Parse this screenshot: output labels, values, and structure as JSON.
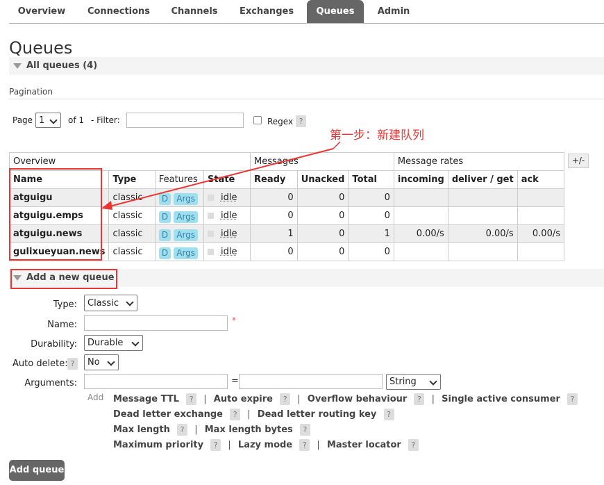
{
  "nav": {
    "tabs": [
      {
        "label": "Overview"
      },
      {
        "label": "Connections"
      },
      {
        "label": "Channels"
      },
      {
        "label": "Exchanges"
      },
      {
        "label": "Queues"
      },
      {
        "label": "Admin"
      }
    ],
    "active": "Queues"
  },
  "page_title": "Queues",
  "all_queues": {
    "label": "All queues (4)"
  },
  "pagination": {
    "label": "Pagination",
    "page_label": "Page",
    "page_value": "1",
    "of_label": "of 1",
    "filter_label": "- Filter:",
    "filter_value": "",
    "regex_label": "Regex",
    "help": "?"
  },
  "annotation": "第一步：新建队列",
  "table": {
    "group_headers": {
      "overview": "Overview",
      "messages": "Messages",
      "rates": "Message rates"
    },
    "toggle": "+/-",
    "columns": [
      "Name",
      "Type",
      "Features",
      "State",
      "Ready",
      "Unacked",
      "Total",
      "incoming",
      "deliver / get",
      "ack"
    ],
    "rows": [
      {
        "name": "atguigu",
        "type": "classic",
        "d": "D",
        "args": "Args",
        "state": "idle",
        "ready": "0",
        "unacked": "0",
        "total": "0",
        "incoming": "",
        "deliver": "",
        "ack": ""
      },
      {
        "name": "atguigu.emps",
        "type": "classic",
        "d": "D",
        "args": "Args",
        "state": "idle",
        "ready": "0",
        "unacked": "0",
        "total": "0",
        "incoming": "",
        "deliver": "",
        "ack": ""
      },
      {
        "name": "atguigu.news",
        "type": "classic",
        "d": "D",
        "args": "Args",
        "state": "idle",
        "ready": "1",
        "unacked": "0",
        "total": "1",
        "incoming": "0.00/s",
        "deliver": "0.00/s",
        "ack": "0.00/s"
      },
      {
        "name": "gulixueyuan.news",
        "type": "classic",
        "d": "D",
        "args": "Args",
        "state": "idle",
        "ready": "0",
        "unacked": "0",
        "total": "0",
        "incoming": "",
        "deliver": "",
        "ack": ""
      }
    ]
  },
  "add_queue": {
    "section_label": "Add a new queue",
    "type_label": "Type:",
    "type_value": "Classic",
    "name_label": "Name:",
    "name_value": "",
    "required_mark": "*",
    "durability_label": "Durability:",
    "durability_value": "Durable",
    "auto_delete_label": "Auto delete:",
    "auto_delete_help": "?",
    "auto_delete_value": "No",
    "arguments_label": "Arguments:",
    "arg_key": "",
    "equals": "=",
    "arg_value": "",
    "arg_type": "String",
    "add_label": "Add",
    "arg_links": [
      [
        "Message TTL",
        "Auto expire",
        "Overflow behaviour",
        "Single active consumer"
      ],
      [
        "Dead letter exchange",
        "Dead letter routing key"
      ],
      [
        "Max length",
        "Max length bytes"
      ],
      [
        "Maximum priority",
        "Lazy mode",
        "Master locator"
      ]
    ],
    "help": "?",
    "separator": "|",
    "submit_label": "Add queue"
  }
}
